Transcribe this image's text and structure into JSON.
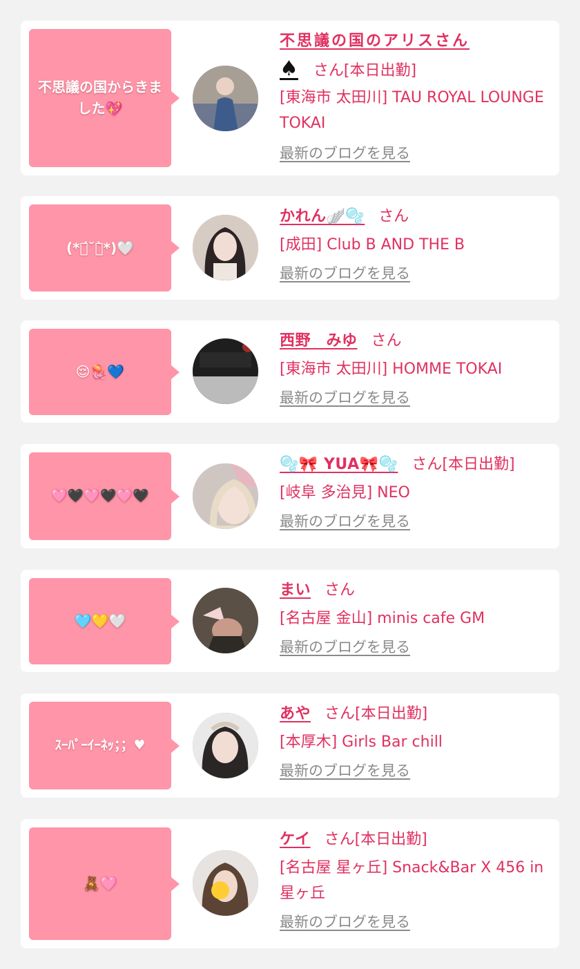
{
  "colors": {
    "accent": "#e03060",
    "bubble": "#ff95a8",
    "card_bg": "#ffffff",
    "page_bg": "#f2f2f2",
    "link_gray": "#8a8a8a"
  },
  "blog_link_label": "最新のブログを見る",
  "cards": [
    {
      "comment": "不思議の国からきました💖",
      "name": "不思議の国のアリスさん",
      "name_extra": "♠",
      "suffix": "さん[本日出勤]",
      "shop": "[東海市 太田川] TAU ROYAL LOUNGE TOKAI",
      "blog": "最新のブログを見る"
    },
    {
      "comment": "(*ฅ́˘ฅ̀*)🤍",
      "name": "かれん🪽🫧",
      "suffix": "さん",
      "shop": "[成田] Club B AND THE B",
      "blog": "最新のブログを見る"
    },
    {
      "comment": "😌🪼💙",
      "name": "西野　みゆ",
      "suffix": "さん",
      "shop": "[東海市 太田川] HOMME TOKAI",
      "blog": "最新のブログを見る"
    },
    {
      "comment": "🩷🖤🩷🖤🩷🖤",
      "name": "🫧🎀 YUA🎀🫧",
      "suffix": "さん[本日出勤]",
      "shop": "[岐阜 多治見] NEO",
      "blog": "最新のブログを見る"
    },
    {
      "comment": "🩵💛🤍",
      "name": "まい",
      "suffix": "さん",
      "shop": "[名古屋 金山] minis cafe GM",
      "blog": "最新のブログを見る"
    },
    {
      "comment": "ｽｰﾊﾟｰｲｰﾈｯ；；♥",
      "name": "あや",
      "suffix": "さん[本日出勤]",
      "shop": "[本厚木] Girls Bar chill",
      "blog": "最新のブログを見る"
    },
    {
      "comment": "🧸🩷",
      "name": "ケイ",
      "suffix": "さん[本日出勤]",
      "shop": "[名古屋 星ヶ丘] Snack&Bar X 456 in 星ヶ丘",
      "blog": "最新のブログを見る"
    }
  ]
}
